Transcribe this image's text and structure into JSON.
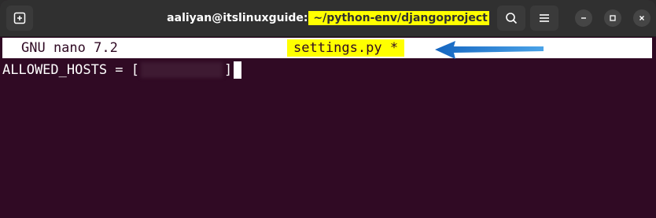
{
  "window": {
    "title_host": "aaliyan@itslinuxguide:",
    "title_path": " ~/python-env/djangoproject"
  },
  "icons": {
    "new_tab": "new-tab-icon",
    "search": "search-icon",
    "menu": "hamburger-menu-icon",
    "minimize": "minimize-icon",
    "maximize": "maximize-icon",
    "close": "close-icon"
  },
  "nano": {
    "version": "GNU nano 7.2",
    "filename": "settings.py *"
  },
  "editor": {
    "line_prefix": "ALLOWED_HOSTS = [",
    "line_suffix": "]"
  },
  "colors": {
    "terminal_bg": "#300a24",
    "highlight": "#ffff00",
    "arrow": "#1a6fc4"
  }
}
